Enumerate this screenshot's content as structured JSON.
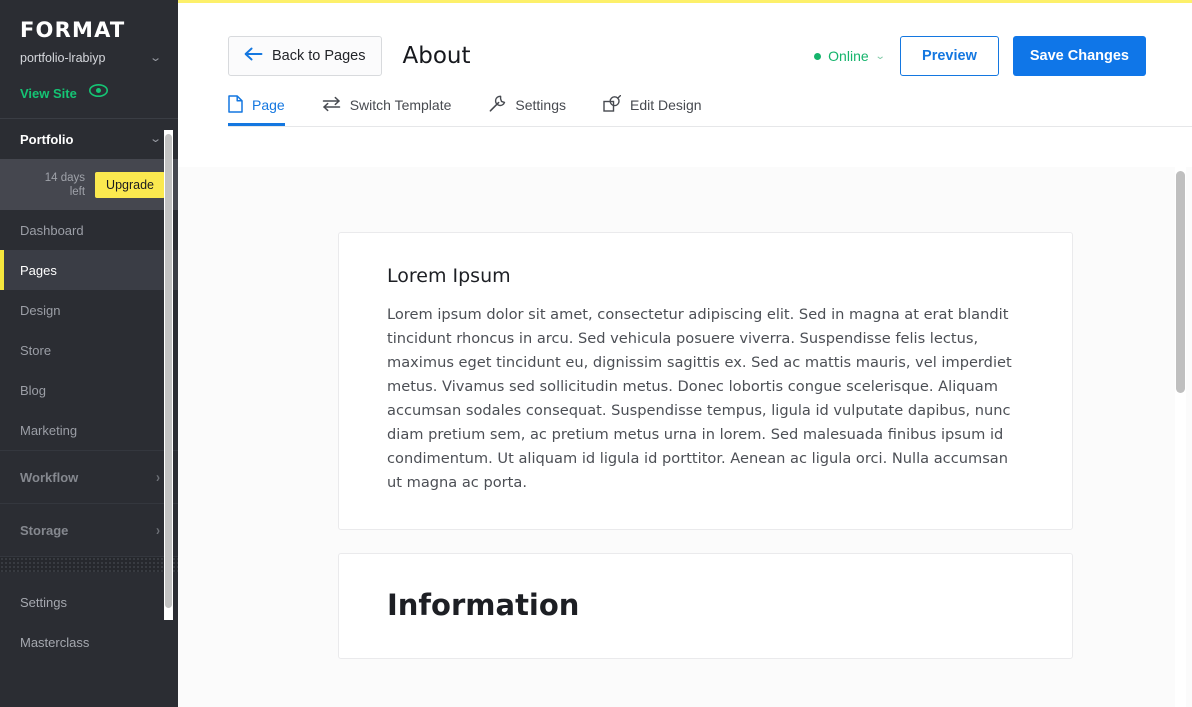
{
  "sidebar": {
    "brand": "FORMAT",
    "account_name": "portfolio-lrabiyp",
    "account_chevron_icon": "chevron-down-icon",
    "view_site": "View Site",
    "eye_icon": "eye-icon",
    "portfolio_label": "Portfolio",
    "portfolio_chevron_icon": "chevron-down-icon",
    "trial": {
      "days_left": "14 days left",
      "upgrade_label": "Upgrade"
    },
    "nav_items": [
      {
        "label": "Dashboard",
        "active": false
      },
      {
        "label": "Pages",
        "active": true
      },
      {
        "label": "Design",
        "active": false
      },
      {
        "label": "Store",
        "active": false
      },
      {
        "label": "Blog",
        "active": false
      },
      {
        "label": "Marketing",
        "active": false
      }
    ],
    "sections": [
      {
        "label": "Workflow",
        "chevron_icon": "chevron-right-icon"
      },
      {
        "label": "Storage",
        "chevron_icon": "chevron-right-icon"
      }
    ],
    "footer_items": [
      {
        "label": "Settings"
      },
      {
        "label": "Masterclass"
      }
    ]
  },
  "header": {
    "back_label": "Back to Pages",
    "back_icon": "arrow-left-icon",
    "page_title": "About",
    "status": {
      "label": "Online",
      "dot_color": "#15b46c",
      "chevron_icon": "chevron-down-icon"
    },
    "preview_label": "Preview",
    "save_label": "Save Changes"
  },
  "tabs": [
    {
      "label": "Page",
      "icon": "document-icon",
      "active": true
    },
    {
      "label": "Switch Template",
      "icon": "swap-arrows-icon",
      "active": false
    },
    {
      "label": "Settings",
      "icon": "wrench-icon",
      "active": false
    },
    {
      "label": "Edit Design",
      "icon": "design-pen-icon",
      "active": false
    }
  ],
  "content": {
    "cards": [
      {
        "heading": "Lorem Ipsum",
        "body": "Lorem ipsum dolor sit amet, consectetur adipiscing elit. Sed in magna at erat blandit tincidunt rhoncus in arcu. Sed vehicula posuere viverra. Suspendisse felis lectus, maximus eget tincidunt eu, dignissim sagittis ex. Sed ac mattis mauris, vel imperdiet metus. Vivamus sed sollicitudin metus. Donec lobortis congue scelerisque. Aliquam accumsan sodales consequat. Suspendisse tempus, ligula id vulputate dapibus, nunc diam pretium sem, ac pretium metus urna in lorem. Sed malesuada finibus ipsum id condimentum. Ut aliquam id ligula id porttitor. Aenean ac ligula orci. Nulla accumsan ut magna ac porta."
      },
      {
        "heading": "Information"
      }
    ]
  },
  "colors": {
    "sidebar_bg": "#2b2d33",
    "accent_yellow": "#f5e63d",
    "top_accent": "#fdf06a",
    "brand_blue": "#0f76e8",
    "online_green": "#15b46c",
    "view_site_green": "#15c474"
  }
}
